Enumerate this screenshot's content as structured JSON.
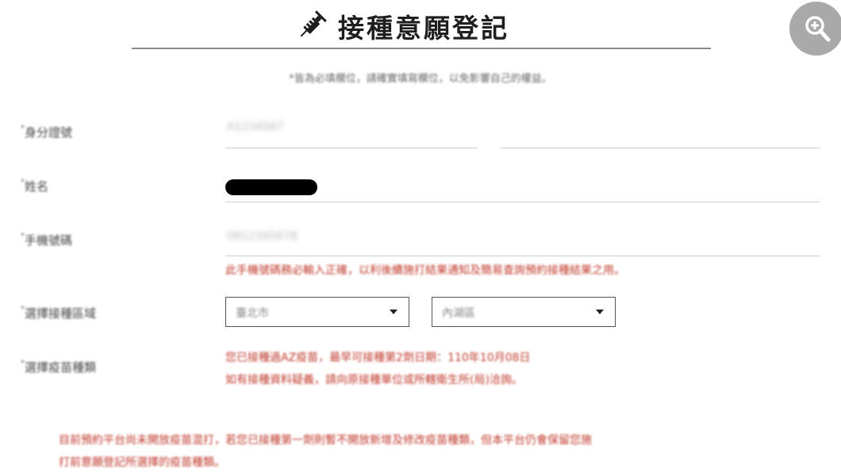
{
  "header": {
    "title": "接種意願登記",
    "title_icon": "syringe-icon",
    "zoom_icon": "zoom-in-icon"
  },
  "form": {
    "required_note": "*皆為必填欄位，請確實填寫欄位，以免影響自己的權益。",
    "id_number": {
      "label": "身分證號",
      "required_mark": "*",
      "value": "A1234567"
    },
    "name": {
      "label": "姓名",
      "required_mark": "*"
    },
    "mobile": {
      "label": "手機號碼",
      "required_mark": "*",
      "value": "0912345678",
      "hint": "此手機號碼務必輸入正確，以利後續施打結果通知及簡易查詢預約接種結果之用。"
    },
    "region": {
      "label": "選擇接種區域",
      "required_mark": "*",
      "city": "臺北市",
      "district": "內湖區"
    },
    "vaccine": {
      "label": "選擇疫苗種類",
      "required_mark": "*",
      "info_line1": "您已接種過AZ疫苗，最早可接種第2劑日期：110年10月08日",
      "info_line2": "如有接種資料疑義，請向原接種單位或所轄衛生所(局)洽詢。"
    },
    "footer_note_line1": "目前預約平台尚未開放疫苗混打，若您已接種第一劑則暫不開放新增及修改疫苗種類，但本平台仍會保留您施",
    "footer_note_line2": "打前意願登記所選擇的疫苗種類。"
  },
  "colors": {
    "accent_red": "#c0392b",
    "zoom_button": "#a9a9a9"
  }
}
